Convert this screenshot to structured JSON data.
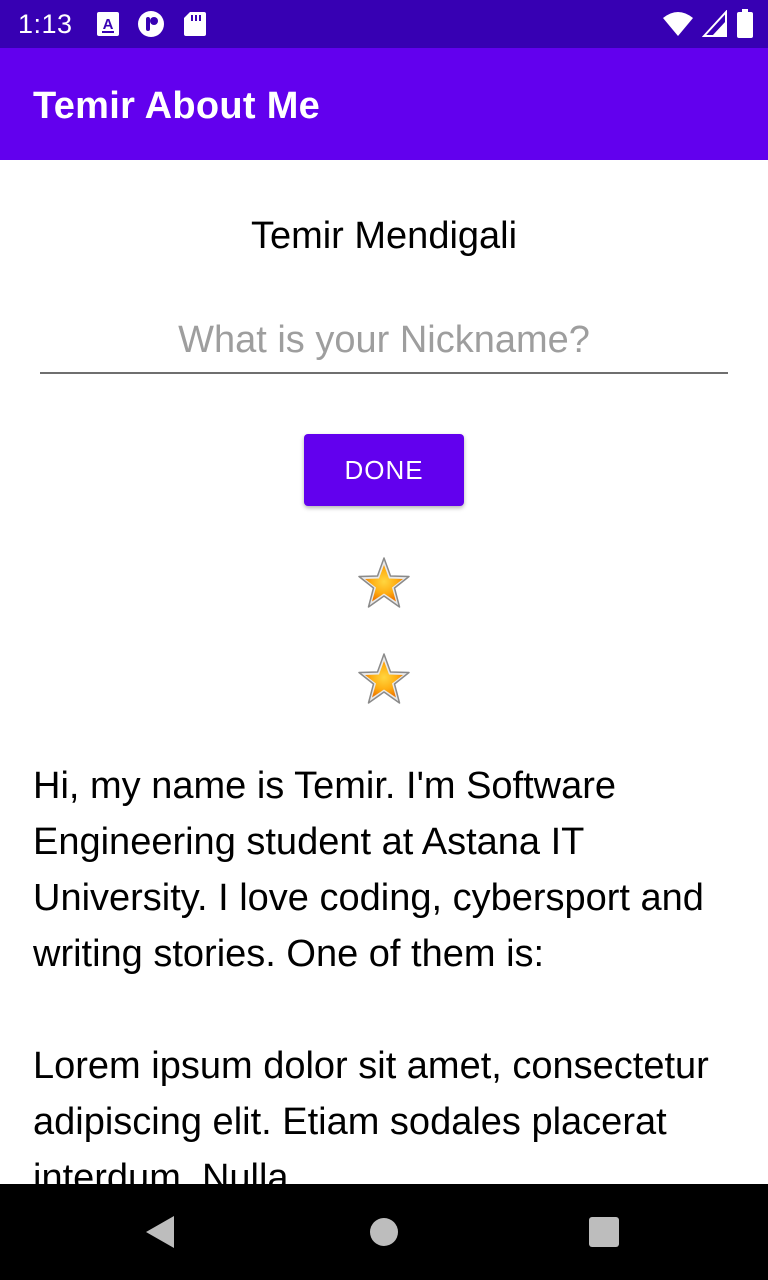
{
  "status_bar": {
    "time": "1:13",
    "left_icons": [
      "font-a-icon",
      "circle-app-icon",
      "sd-card-icon"
    ],
    "right_icons": [
      "wifi-icon",
      "cell-signal-icon",
      "battery-icon"
    ]
  },
  "app_bar": {
    "title": "Temir About Me"
  },
  "profile": {
    "name": "Temir Mendigali",
    "nickname_placeholder": "What is your Nickname?",
    "nickname_value": "",
    "done_label": "DONE",
    "stars": [
      "star-icon",
      "star-icon"
    ],
    "bio": "Hi, my name is Temir. I'm Software Engineering student at Astana IT University. I love coding, cybersport and writing stories. One of them is:\n\nLorem ipsum dolor sit amet, consectetur adipiscing elit. Etiam sodales placerat interdum. Nulla"
  },
  "nav_bar": {
    "buttons": [
      "back-icon",
      "home-icon",
      "recents-icon"
    ]
  },
  "colors": {
    "status_bar": "#3700b3",
    "primary": "#6200ee",
    "nav_bar": "#000000"
  }
}
